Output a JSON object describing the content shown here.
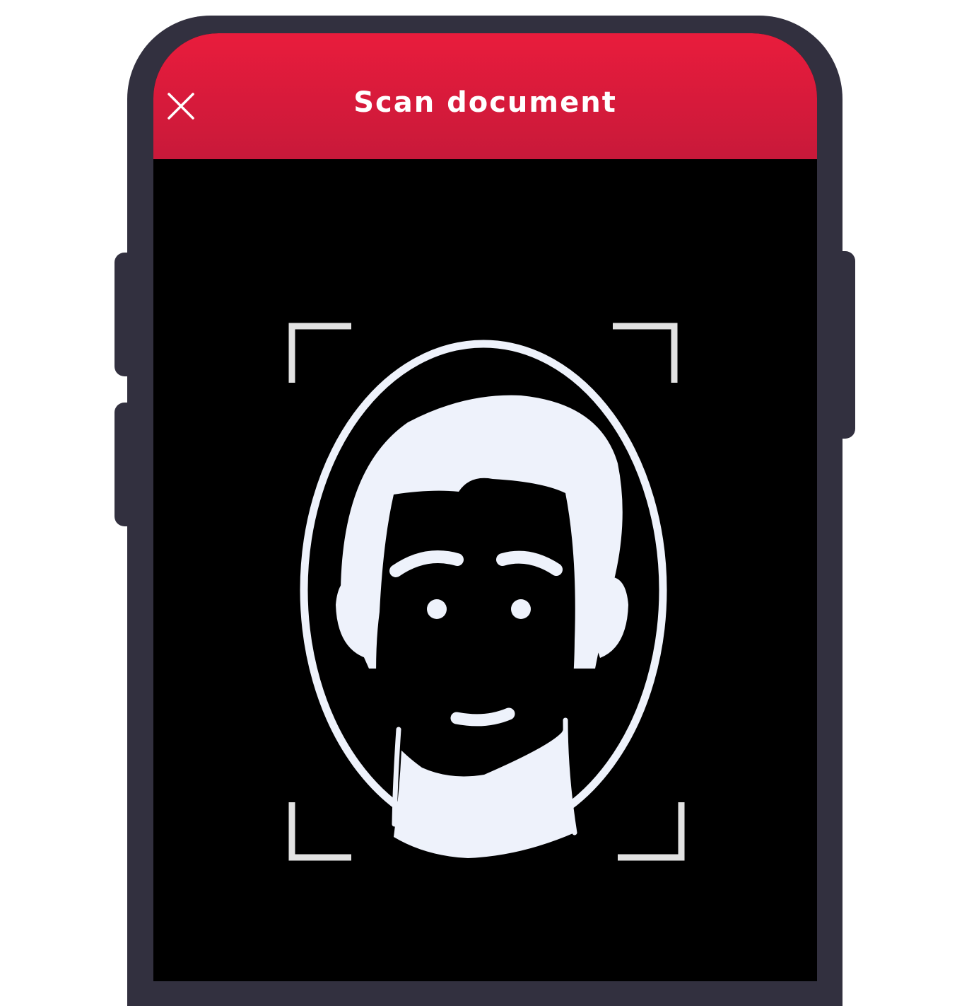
{
  "header": {
    "title": "Scan document",
    "close_icon": "close-icon",
    "background_color": "#e11b3c"
  },
  "camera_view": {
    "overlay_icon": "face-scan-guide-icon",
    "background_color": "#000000",
    "guide_color": "#eef2fb"
  },
  "device": {
    "frame_color": "#32303f"
  }
}
